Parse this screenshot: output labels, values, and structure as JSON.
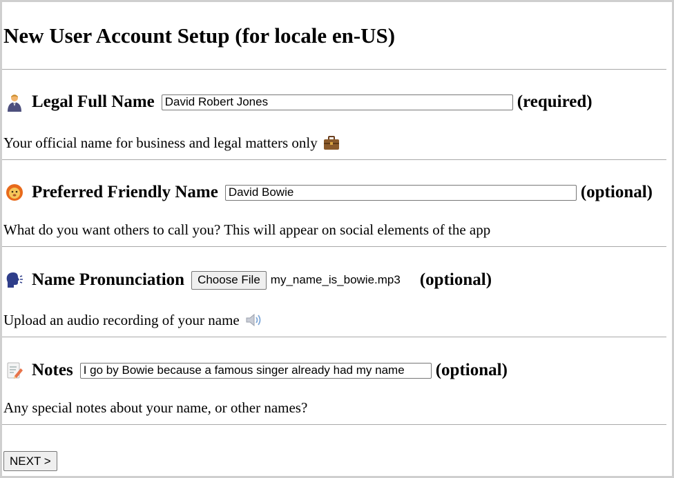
{
  "page": {
    "title": "New User Account Setup (for locale en-US)"
  },
  "fields": {
    "legal": {
      "icon": "person-in-tuxedo-icon",
      "label": "Legal Full Name",
      "value": "David Robert Jones",
      "tag": "(required)",
      "help": "Your official name for business and legal matters only",
      "help_icon": "briefcase-icon"
    },
    "friendly": {
      "icon": "lion-face-icon",
      "label": "Preferred Friendly Name",
      "value": "David Bowie",
      "tag": "(optional)",
      "help": "What do you want others to call you? This will appear on social elements of the app"
    },
    "pronunciation": {
      "icon": "speaking-head-icon",
      "label": "Name Pronunciation",
      "button_label": "Choose File",
      "file_name": "my_name_is_bowie.mp3",
      "tag": "(optional)",
      "help": "Upload an audio recording of your name",
      "help_icon": "speaker-icon"
    },
    "notes": {
      "icon": "memo-icon",
      "label": "Notes",
      "value": "I go by Bowie because a famous singer already had my name",
      "tag": "(optional)",
      "help": "Any special notes about your name, or other names?"
    }
  },
  "actions": {
    "next_label": "NEXT >"
  },
  "colors": {
    "frame_border": "#cfcfcf",
    "divider": "#a8a8a8",
    "button_bg": "#efefef",
    "input_border": "#767676"
  }
}
